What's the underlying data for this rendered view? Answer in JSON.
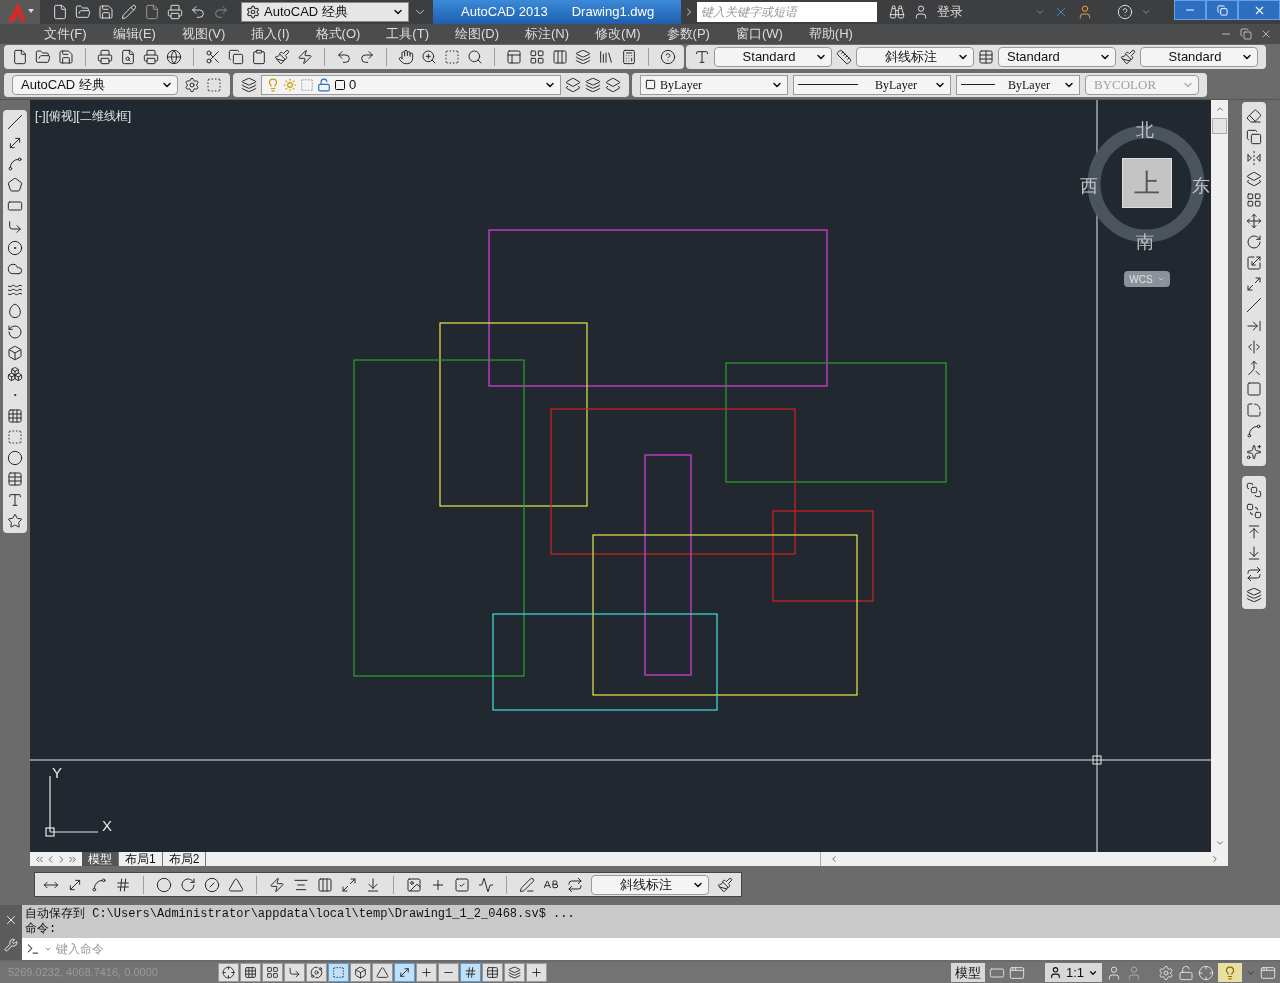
{
  "title_bar": {
    "workspace": "AutoCAD 经典",
    "app": "AutoCAD 2013",
    "document": "Drawing1.dwg",
    "search": {
      "placeholder": "键入关键字或短语"
    },
    "login": "登录"
  },
  "menu": [
    "文件(F)",
    "编辑(E)",
    "视图(V)",
    "插入(I)",
    "格式(O)",
    "工具(T)",
    "绘图(D)",
    "标注(N)",
    "修改(M)",
    "参数(P)",
    "窗口(W)",
    "帮助(H)"
  ],
  "styles_toolbar": {
    "text_style": "Standard",
    "dim_style": "斜线标注",
    "table_style": "Standard",
    "mleader_style": "Standard"
  },
  "workspace_toolbar": {
    "workspace": "AutoCAD 经典"
  },
  "layers_toolbar": {
    "layer": "0"
  },
  "properties_toolbar": {
    "color_setting": "ByLayer",
    "linetype": "ByLayer",
    "lineweight": "ByLayer",
    "plot_style": {
      "value": "BYCOLOR",
      "disabled": true
    }
  },
  "viewport": {
    "label": "[-][俯视][二维线框]"
  },
  "viewcube": {
    "north": "北",
    "south": "南",
    "east": "东",
    "west": "西",
    "face": "上",
    "coordinate_system": "WCS"
  },
  "ucs": {
    "y": "Y",
    "x": "X"
  },
  "layout_tabs": [
    {
      "label": "模型",
      "selected": true
    },
    {
      "label": "布局1",
      "selected": false
    },
    {
      "label": "布局2",
      "selected": false
    }
  ],
  "dimension_toolbar": {
    "dim_style": "斜线标注"
  },
  "command_history": [
    "自动保存到 C:\\Users\\Administrator\\appdata\\local\\temp\\Drawing1_1_2_0468.sv$ ...",
    "命令:"
  ],
  "command_input": {
    "placeholder": "键入命令"
  },
  "status_bar": {
    "coordinates": "5269.0232, 4068.7416, 0.0000",
    "toggles": [
      {
        "on": false
      },
      {
        "on": false
      },
      {
        "on": false
      },
      {
        "on": false
      },
      {
        "on": false
      },
      {
        "on": true
      },
      {
        "on": false
      },
      {
        "on": false
      },
      {
        "on": true
      },
      {
        "on": false
      },
      {
        "on": false
      },
      {
        "on": true
      },
      {
        "on": false
      },
      {
        "on": false
      },
      {
        "on": false
      }
    ],
    "space": "模型",
    "annotation_scale": "1:1"
  }
}
